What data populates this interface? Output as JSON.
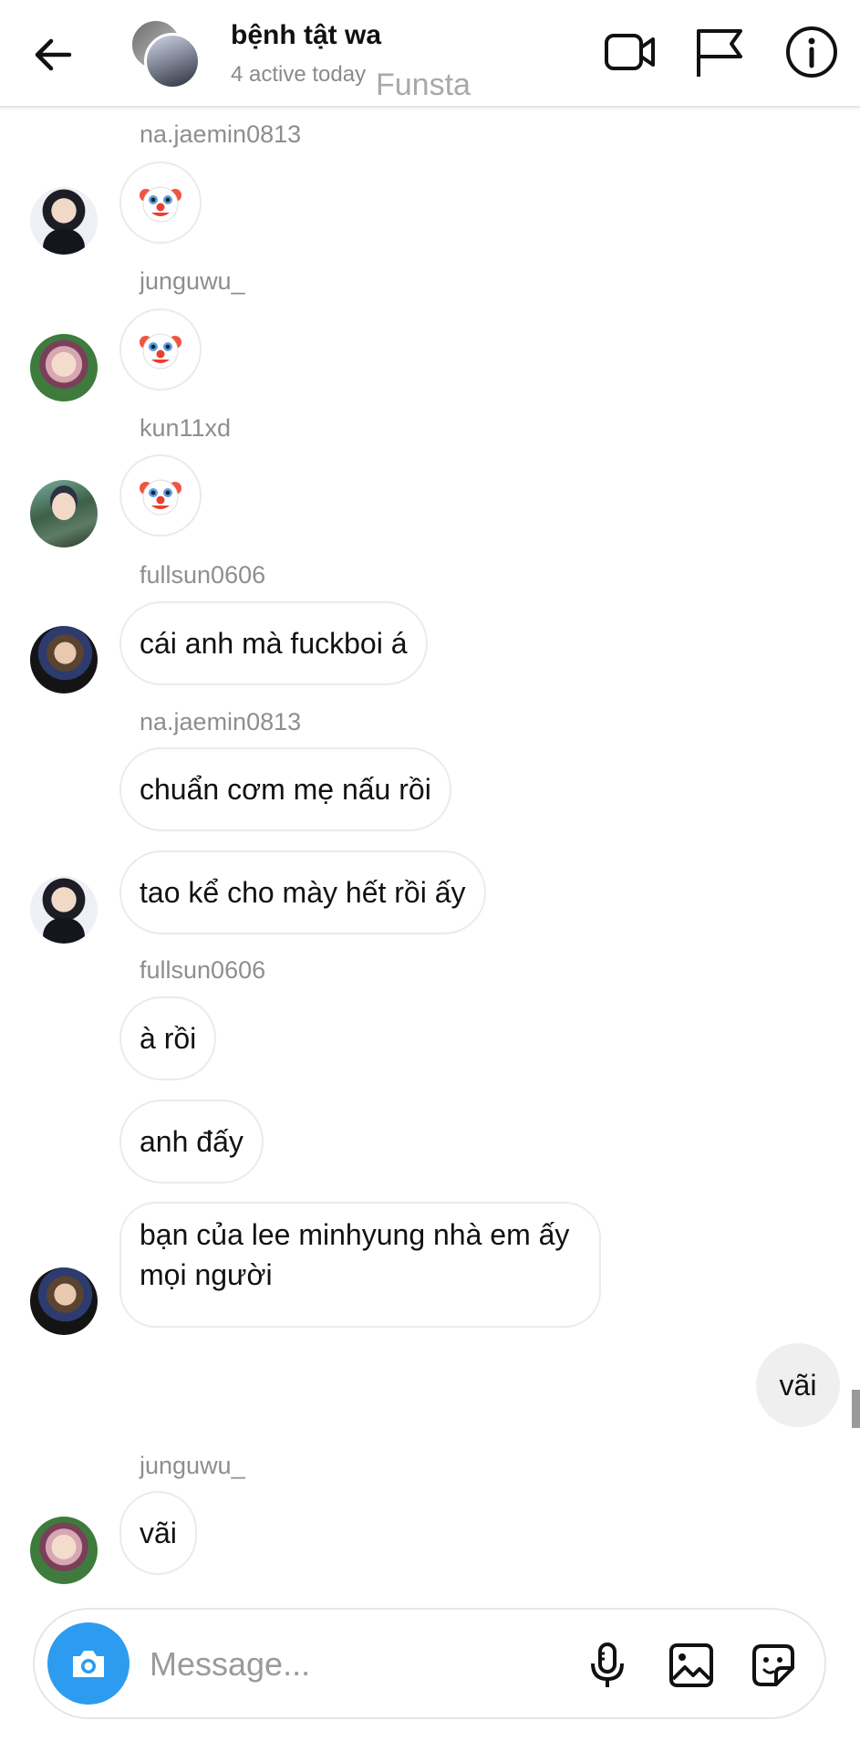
{
  "header": {
    "group_name": "bệnh tật wa",
    "status": "4 active today",
    "watermark": "Funsta",
    "icons": [
      "back-arrow-icon",
      "video-call-icon",
      "flag-icon",
      "info-icon"
    ]
  },
  "messages": [
    {
      "sender": "na.jaemin0813",
      "text": "🤡"
    },
    {
      "sender": "junguwu_",
      "text": "🤡"
    },
    {
      "sender": "kun11xd",
      "text": "🤡"
    },
    {
      "sender": "fullsun0606",
      "text": "cái anh mà fuckboi á"
    },
    {
      "sender": "na.jaemin0813",
      "text": "chuẩn cơm mẹ nấu rồi"
    },
    {
      "sender": "na.jaemin0813",
      "text": "tao kể cho mày hết rồi ấy"
    },
    {
      "sender": "fullsun0606",
      "text": "à rồi"
    },
    {
      "sender": "fullsun0606",
      "text": "anh đấy"
    },
    {
      "sender": "fullsun0606",
      "text": "bạn của lee minhyung nhà em ấy mọi người"
    },
    {
      "sender": "me",
      "text": "vãi"
    },
    {
      "sender": "junguwu_",
      "text": "vãi"
    }
  ],
  "composer": {
    "placeholder": "Message...",
    "icons": [
      "camera-icon",
      "microphone-icon",
      "gallery-icon",
      "sticker-icon"
    ]
  },
  "colors": {
    "accent": "#2d9bf0",
    "bubble_border": "#ebebeb",
    "outgoing_bubble": "#efefef",
    "meta_text": "#8e8e8e"
  }
}
